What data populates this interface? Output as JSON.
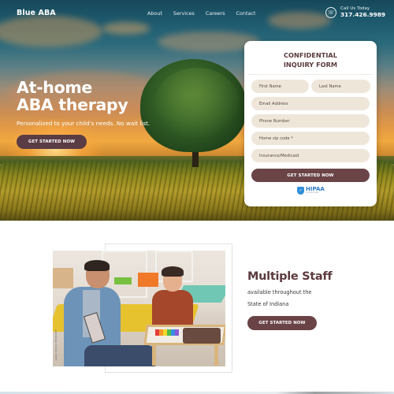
{
  "header": {
    "logo": "Blue ABA",
    "nav": [
      {
        "label": "About"
      },
      {
        "label": "Services"
      },
      {
        "label": "Careers"
      },
      {
        "label": "Contact"
      }
    ],
    "call": {
      "icon": "phone-icon",
      "label": "Call Us Today",
      "number": "317.426.9989"
    }
  },
  "hero": {
    "title_line1": "At-home",
    "title_line2": "ABA therapy",
    "subtitle": "Personalized to your child's needs. No wait list.",
    "cta_label": "GET STARTED NOW"
  },
  "form": {
    "title_line1": "CONFIDENTIAL",
    "title_line2": "INQUIRY FORM",
    "fields": {
      "first_name": {
        "placeholder": "First Name",
        "value": ""
      },
      "last_name": {
        "placeholder": "Last Name",
        "value": ""
      },
      "email": {
        "placeholder": "Email Address",
        "value": ""
      },
      "phone": {
        "placeholder": "Phone Number",
        "value": ""
      },
      "zip": {
        "placeholder": "Home zip code *",
        "value": ""
      },
      "insurance": {
        "placeholder": "Insurance/Medicaid",
        "value": ""
      }
    },
    "submit_label": "GET STARTED NOW",
    "badge": {
      "icon": "shield-icon",
      "main": "HIPAA",
      "sub": "COMPLIANT"
    }
  },
  "staff_section": {
    "photo_alt": "Therapist working with a child at a table",
    "photo_watermark": "Adobe Stock | #######",
    "title": "Multiple Staff",
    "line1": "available throughout the",
    "line2": "State of Indiana",
    "cta_label": "GET STARTED NOW"
  },
  "colors": {
    "accent": "#6a4346",
    "accent_dark": "#5a3c45",
    "heading": "#5b3a3e",
    "field_bg": "#efe6da",
    "hipaa_blue": "#2d79c4"
  }
}
